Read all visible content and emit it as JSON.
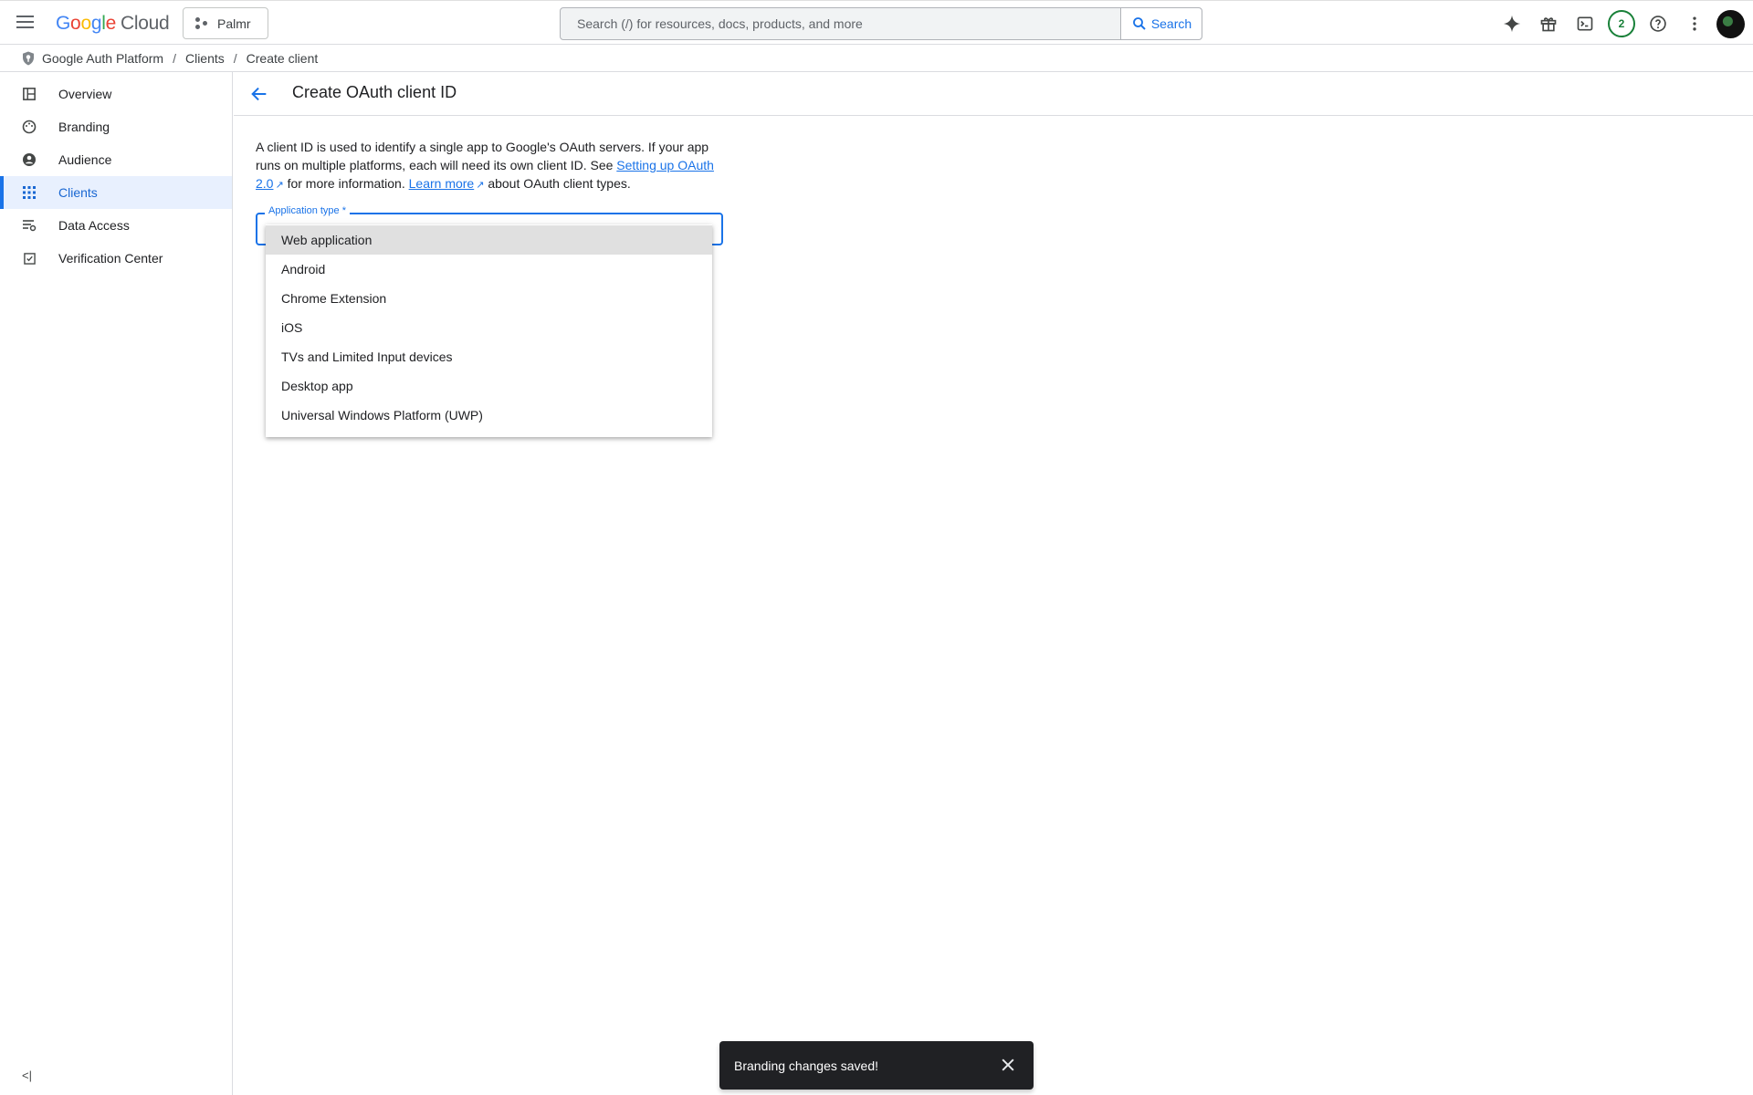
{
  "header": {
    "logo_parts": [
      "G",
      "o",
      "o",
      "g",
      "l",
      "e"
    ],
    "logo_suffix": "Cloud",
    "project_name": "Palmr",
    "search_placeholder": "Search (/) for resources, docs, products, and more",
    "search_button": "Search",
    "notification_count": "2",
    "icons": [
      "menu-icon",
      "gemini-spark-icon",
      "gift-icon",
      "cloud-shell-icon",
      "help-icon",
      "more-vert-icon"
    ]
  },
  "breadcrumb": {
    "items": [
      "Google Auth Platform",
      "Clients",
      "Create client"
    ],
    "separator": "/"
  },
  "sidebar": {
    "items": [
      {
        "label": "Overview",
        "icon": "dashboard-icon",
        "active": false
      },
      {
        "label": "Branding",
        "icon": "palette-icon",
        "active": false
      },
      {
        "label": "Audience",
        "icon": "account-circle-icon",
        "active": false
      },
      {
        "label": "Clients",
        "icon": "apps-grid-icon",
        "active": true
      },
      {
        "label": "Data Access",
        "icon": "data-settings-icon",
        "active": false
      },
      {
        "label": "Verification Center",
        "icon": "verified-box-icon",
        "active": false
      }
    ],
    "collapse_label": "<|"
  },
  "main": {
    "title": "Create OAuth client ID",
    "description": {
      "part1": "A client ID is used to identify a single app to Google's OAuth servers. If your app runs on multiple platforms, each will need its own client ID. See ",
      "link1": "Setting up OAuth 2.0",
      "part2": " for more information. ",
      "link2": "Learn more",
      "part3": " about OAuth client types."
    },
    "field_label": "Application type *",
    "options": [
      "Web application",
      "Android",
      "Chrome Extension",
      "iOS",
      "TVs and Limited Input devices",
      "Desktop app",
      "Universal Windows Platform (UWP)"
    ],
    "highlighted_option": "Web application"
  },
  "toast": {
    "message": "Branding changes saved!"
  },
  "colors": {
    "accent": "#1a73e8",
    "active_bg": "#e8f0fe",
    "toast_bg": "#202124",
    "notif_green": "#188038"
  }
}
